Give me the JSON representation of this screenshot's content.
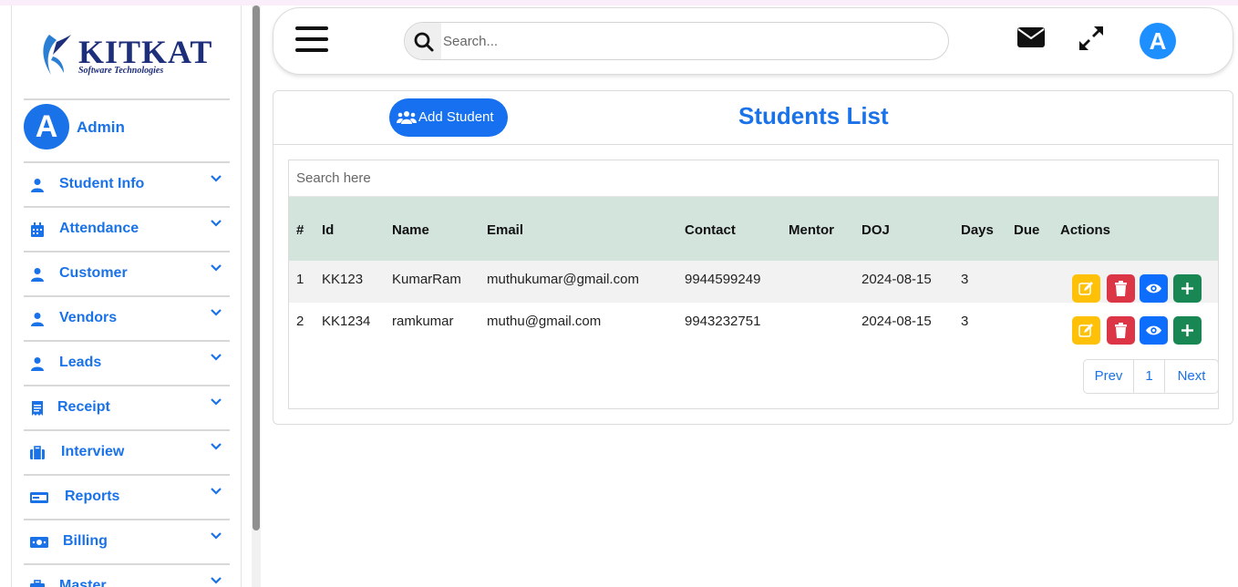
{
  "sidebar": {
    "logo": {
      "name": "KITKAT",
      "tagline": "Software Technologies"
    },
    "user": {
      "initial": "A",
      "name": "Admin"
    },
    "items": [
      {
        "label": "Student Info",
        "icon": "user-icon"
      },
      {
        "label": "Attendance",
        "icon": "calendar-icon"
      },
      {
        "label": "Customer",
        "icon": "user-icon"
      },
      {
        "label": "Vendors",
        "icon": "user-icon"
      },
      {
        "label": "Leads",
        "icon": "user-icon"
      },
      {
        "label": "Receipt",
        "icon": "receipt-icon"
      },
      {
        "label": "Interview",
        "icon": "briefcase-icon"
      },
      {
        "label": "Reports",
        "icon": "card-icon"
      },
      {
        "label": "Billing",
        "icon": "money-icon"
      },
      {
        "label": "Master",
        "icon": "briefcase-icon"
      }
    ]
  },
  "header": {
    "search_placeholder": "Search...",
    "avatar_initial": "A"
  },
  "main": {
    "add_button_label": "Add Student",
    "title": "Students List",
    "table_search_placeholder": "Search here",
    "columns": [
      "#",
      "Id",
      "Name",
      "Email",
      "Contact",
      "Mentor",
      "DOJ",
      "Days",
      "Due",
      "Actions"
    ],
    "rows": [
      {
        "num": "1",
        "id": "KK123",
        "name": "KumarRam",
        "email": "muthukumar@gmail.com",
        "contact": "9944599249",
        "mentor": "",
        "doj": "2024-08-15",
        "days": "3",
        "due": ""
      },
      {
        "num": "2",
        "id": "KK1234",
        "name": "ramkumar",
        "email": "muthu@gmail.com",
        "contact": "9943232751",
        "mentor": "",
        "doj": "2024-08-15",
        "days": "3",
        "due": ""
      }
    ],
    "pagination": {
      "prev": "Prev",
      "page": "1",
      "next": "Next"
    }
  },
  "colors": {
    "accent": "#1a72e8",
    "table_header_bg": "#d2e4dc",
    "edit": "#ffc107",
    "delete": "#dc3545",
    "view": "#0d6efd",
    "add": "#198754"
  }
}
